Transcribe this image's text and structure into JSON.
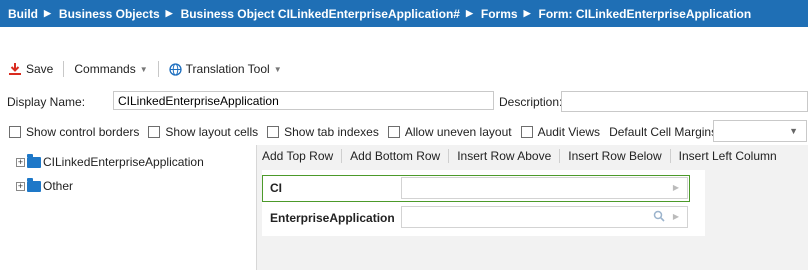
{
  "breadcrumb": [
    {
      "label": "Build"
    },
    {
      "label": "Business Objects"
    },
    {
      "label": "Business Object CILinkedEnterpriseApplication#"
    },
    {
      "label": "Forms"
    },
    {
      "label": "Form: CILinkedEnterpriseApplication"
    }
  ],
  "breadcrumb_separator": "▶",
  "toolbar": {
    "save_label": "Save",
    "commands_label": "Commands",
    "translation_label": "Translation Tool",
    "caret": "▼"
  },
  "form_meta": {
    "display_name_label": "Display Name:",
    "display_name_value": "CILinkedEnterpriseApplication",
    "description_label": "Description:",
    "description_value": ""
  },
  "options": {
    "show_control_borders": "Show control borders",
    "show_layout_cells": "Show layout cells",
    "show_tab_indexes": "Show tab indexes",
    "allow_uneven_layout": "Allow uneven layout",
    "audit_views": "Audit Views",
    "default_cell_margins": "Default Cell Margins",
    "margins_value": ""
  },
  "tree": {
    "items": [
      {
        "label": "CILinkedEnterpriseApplication"
      },
      {
        "label": "Other"
      }
    ]
  },
  "row_actions": {
    "add_top_row": "Add Top Row",
    "add_bottom_row": "Add Bottom Row",
    "insert_row_above": "Insert Row Above",
    "insert_row_below": "Insert Row Below",
    "insert_left_column": "Insert Left Column"
  },
  "fields": {
    "ci_label": "CI",
    "enterprise_app_label": "EnterpriseApplication"
  },
  "colors": {
    "topbar": "#1f6fb5",
    "save_icon": "#d92b1f",
    "selection": "#4c9a2a"
  }
}
